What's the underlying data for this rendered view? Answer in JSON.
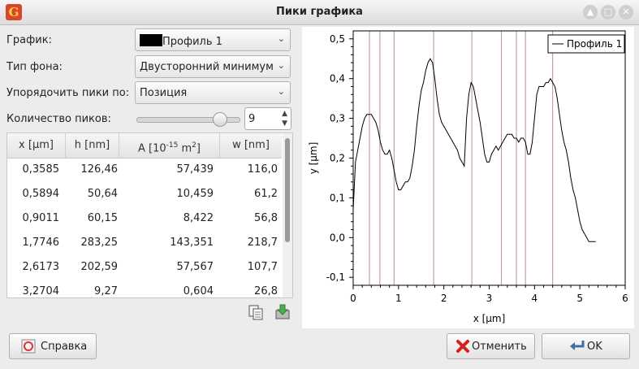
{
  "window": {
    "title": "Пики графика"
  },
  "form": {
    "graph_label": "График:",
    "graph_value": "Профиль 1",
    "bg_label": "Тип фона:",
    "bg_value": "Двусторонний минимум",
    "order_label": "Упорядочить пики по:",
    "order_value": "Позиция",
    "count_label": "Количество пиков:",
    "count_value": "9",
    "slider_value": 9
  },
  "table": {
    "headers": [
      "x [µm]",
      "h [nm]",
      "A [10",
      "w [nm]"
    ],
    "header_a_exp": "-15",
    "header_a_unit": " m",
    "header_a_sq": "2",
    "header_a_close": "]",
    "rows": [
      [
        "0,3585",
        "126,46",
        "57,439",
        "116,0"
      ],
      [
        "0,5894",
        "50,64",
        "10,459",
        "61,2"
      ],
      [
        "0,9011",
        "60,15",
        "8,422",
        "56,8"
      ],
      [
        "1,7746",
        "283,25",
        "143,351",
        "218,7"
      ],
      [
        "2,6173",
        "202,59",
        "57,567",
        "107,7"
      ],
      [
        "3,2704",
        "9,27",
        "0,604",
        "26,8"
      ]
    ]
  },
  "buttons": {
    "help": "Справка",
    "cancel": "Отменить",
    "ok": "OK"
  },
  "chart_data": {
    "type": "line",
    "xlabel": "x [µm]",
    "ylabel": "y [µm]",
    "xlim": [
      0,
      6
    ],
    "ylim": [
      -0.12,
      0.52
    ],
    "xticks": [
      "0",
      "1",
      "2",
      "3",
      "4",
      "5",
      "6"
    ],
    "yticks": [
      "-0,1",
      "0,0",
      "0,1",
      "0,2",
      "0,3",
      "0,4",
      "0,5"
    ],
    "legend": "Профиль 1",
    "peak_positions": [
      0.3585,
      0.5894,
      0.9011,
      1.7746,
      2.6173,
      3.2704,
      3.6,
      3.8,
      4.4
    ],
    "series": [
      {
        "name": "Профиль 1",
        "x": [
          0,
          0.05,
          0.1,
          0.15,
          0.2,
          0.25,
          0.3,
          0.35,
          0.4,
          0.45,
          0.5,
          0.55,
          0.6,
          0.65,
          0.7,
          0.75,
          0.8,
          0.85,
          0.9,
          0.95,
          1.0,
          1.05,
          1.1,
          1.15,
          1.2,
          1.25,
          1.3,
          1.35,
          1.4,
          1.45,
          1.5,
          1.55,
          1.6,
          1.65,
          1.7,
          1.75,
          1.8,
          1.85,
          1.9,
          1.95,
          2.0,
          2.05,
          2.1,
          2.15,
          2.2,
          2.25,
          2.3,
          2.35,
          2.4,
          2.45,
          2.5,
          2.55,
          2.6,
          2.65,
          2.7,
          2.75,
          2.8,
          2.85,
          2.9,
          2.95,
          3.0,
          3.05,
          3.1,
          3.15,
          3.2,
          3.25,
          3.3,
          3.35,
          3.4,
          3.45,
          3.5,
          3.55,
          3.6,
          3.65,
          3.7,
          3.75,
          3.8,
          3.85,
          3.9,
          3.95,
          4.0,
          4.05,
          4.1,
          4.15,
          4.2,
          4.25,
          4.3,
          4.35,
          4.4,
          4.45,
          4.5,
          4.55,
          4.6,
          4.65,
          4.7,
          4.75,
          4.8,
          4.85,
          4.9,
          4.95,
          5.0,
          5.05,
          5.1,
          5.15,
          5.2,
          5.25,
          5.3,
          5.35
        ],
        "y": [
          0.07,
          0.19,
          0.22,
          0.25,
          0.28,
          0.3,
          0.31,
          0.31,
          0.31,
          0.3,
          0.29,
          0.27,
          0.24,
          0.22,
          0.21,
          0.21,
          0.22,
          0.2,
          0.17,
          0.14,
          0.12,
          0.12,
          0.13,
          0.14,
          0.14,
          0.15,
          0.18,
          0.22,
          0.28,
          0.33,
          0.37,
          0.39,
          0.42,
          0.44,
          0.45,
          0.44,
          0.4,
          0.35,
          0.31,
          0.29,
          0.28,
          0.27,
          0.26,
          0.25,
          0.24,
          0.23,
          0.22,
          0.2,
          0.19,
          0.18,
          0.3,
          0.36,
          0.39,
          0.38,
          0.35,
          0.32,
          0.29,
          0.25,
          0.21,
          0.19,
          0.19,
          0.21,
          0.22,
          0.23,
          0.22,
          0.23,
          0.24,
          0.25,
          0.26,
          0.26,
          0.26,
          0.25,
          0.25,
          0.24,
          0.25,
          0.25,
          0.24,
          0.21,
          0.21,
          0.24,
          0.3,
          0.36,
          0.38,
          0.38,
          0.38,
          0.39,
          0.39,
          0.4,
          0.39,
          0.38,
          0.35,
          0.31,
          0.27,
          0.24,
          0.22,
          0.19,
          0.15,
          0.12,
          0.1,
          0.07,
          0.04,
          0.02,
          0.01,
          -0.0,
          -0.01,
          -0.01,
          -0.01,
          -0.01
        ]
      }
    ]
  }
}
